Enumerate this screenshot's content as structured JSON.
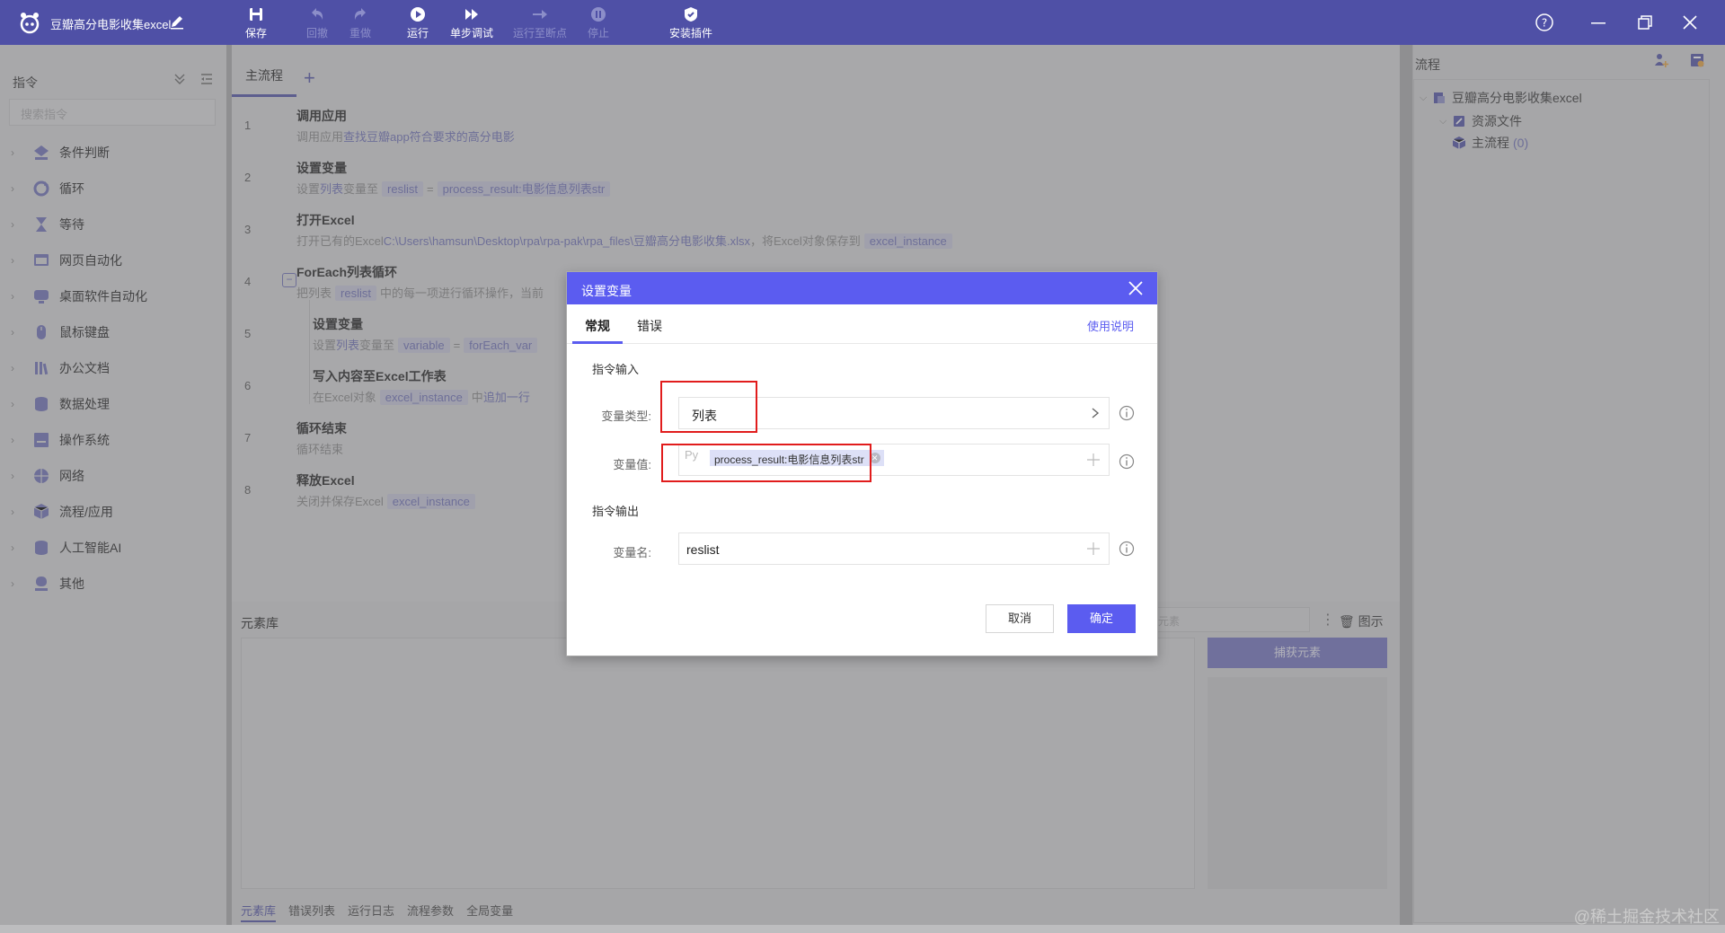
{
  "app": {
    "title": "豆瓣高分电影收集excel"
  },
  "toolbar": {
    "items": [
      {
        "label": "保存",
        "enabled": true
      },
      {
        "label": "回撤",
        "enabled": false
      },
      {
        "label": "重做",
        "enabled": false
      },
      {
        "label": "运行",
        "enabled": true
      },
      {
        "label": "单步调试",
        "enabled": true
      },
      {
        "label": "运行至断点",
        "enabled": false
      },
      {
        "label": "停止",
        "enabled": false
      },
      {
        "label": "安装插件",
        "enabled": true
      }
    ]
  },
  "left_panel": {
    "title": "指令",
    "search_placeholder": "搜索指令",
    "categories": [
      {
        "label": "条件判断",
        "icon": "condition-icon"
      },
      {
        "label": "循环",
        "icon": "loop-icon"
      },
      {
        "label": "等待",
        "icon": "hourglass-icon"
      },
      {
        "label": "网页自动化",
        "icon": "web-icon"
      },
      {
        "label": "桌面软件自动化",
        "icon": "desktop-icon"
      },
      {
        "label": "鼠标键盘",
        "icon": "mouse-icon"
      },
      {
        "label": "办公文档",
        "icon": "office-icon"
      },
      {
        "label": "数据处理",
        "icon": "database-icon"
      },
      {
        "label": "操作系统",
        "icon": "system-icon"
      },
      {
        "label": "网络",
        "icon": "network-icon"
      },
      {
        "label": "流程/应用",
        "icon": "flow-icon"
      },
      {
        "label": "人工智能AI",
        "icon": "ai-icon"
      },
      {
        "label": "其他",
        "icon": "other-icon"
      }
    ]
  },
  "flow": {
    "tab": "主流程",
    "rows": [
      {
        "num": "1",
        "title": "调用应用",
        "desc_prefix": "调用应用",
        "desc_link": "查找豆瓣app符合要求的高分电影"
      },
      {
        "num": "2",
        "title": "设置变量",
        "desc_prefix": "设置",
        "desc_link": "列表",
        "desc_mid": "变量至",
        "tag1": "reslist",
        "eq": "=",
        "tag2": "process_result:电影信息列表str"
      },
      {
        "num": "3",
        "title": "打开Excel",
        "desc_prefix": "打开已有的Excel",
        "desc_path": "C:\\Users\\hamsun\\Desktop\\rpa\\rpa-pak\\rpa_files\\豆瓣高分电影收集.xlsx",
        "desc_mid": "，将Excel对象保存到",
        "tag1": "excel_instance"
      },
      {
        "num": "4",
        "title": "ForEach列表循环",
        "desc_prefix": "把列表",
        "tag1": "reslist",
        "desc_mid": "中的每一项进行循环操作，当前"
      },
      {
        "num": "5",
        "title": "设置变量",
        "desc_prefix": "设置",
        "desc_link": "列表",
        "desc_mid": "变量至",
        "tag1": "variable",
        "eq": "=",
        "tag2": "forEach_var"
      },
      {
        "num": "6",
        "title": "写入内容至Excel工作表",
        "desc_prefix": "在Excel对象",
        "tag1": "excel_instance",
        "desc_mid": "中",
        "desc_link": "追加一行"
      },
      {
        "num": "7",
        "title": "循环结束",
        "desc_prefix": "循环结束"
      },
      {
        "num": "8",
        "title": "释放Excel",
        "desc_prefix": "关闭并保存Excel",
        "tag1": "excel_instance"
      }
    ]
  },
  "element_library": {
    "title": "元素库",
    "search_placeholder": "元素",
    "show_picture": "图示",
    "capture_button": "捕获元素",
    "bottom_tabs": [
      "元素库",
      "错误列表",
      "运行日志",
      "流程参数",
      "全局变量"
    ]
  },
  "right_panel": {
    "title": "流程",
    "tree": [
      {
        "label": "豆瓣高分电影收集excel",
        "level": 0
      },
      {
        "label": "资源文件",
        "level": 1
      },
      {
        "label": "主流程",
        "count": "(0)",
        "level": 1
      }
    ]
  },
  "dialog": {
    "title": "设置变量",
    "tabs": [
      "常规",
      "错误"
    ],
    "help_link": "使用说明",
    "input_section": "指令输入",
    "var_type_label": "变量类型:",
    "var_type_value": "列表",
    "var_value_label": "变量值:",
    "py_label": "Py",
    "var_value_chip": "process_result:电影信息列表str",
    "output_section": "指令输出",
    "var_name_label": "变量名:",
    "var_name_value": "reslist",
    "cancel": "取消",
    "ok": "确定"
  },
  "watermark": "@稀土掘金技术社区",
  "colors": {
    "brand": "#4f50a6",
    "dialog_accent": "#5b5cf0",
    "highlight_red": "#e11c1c"
  }
}
